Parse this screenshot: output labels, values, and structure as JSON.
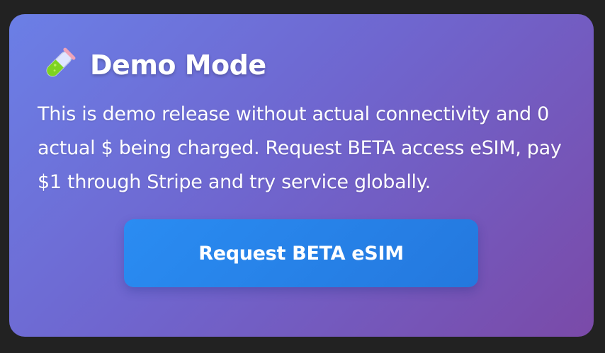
{
  "card": {
    "title": "Demo Mode",
    "icon": "test-tube-icon",
    "description": "This is demo release without actual connectivity and 0 actual $ being charged. Request BETA access eSIM, pay $1 through Stripe and try service globally.",
    "button_label": "Request BETA eSIM"
  },
  "colors": {
    "page_background": "#222222",
    "card_gradient_start": "#6b7fe6",
    "card_gradient_end": "#7a4aa8",
    "button_start": "#2a8cf2",
    "button_end": "#2478de",
    "text": "#ffffff"
  }
}
